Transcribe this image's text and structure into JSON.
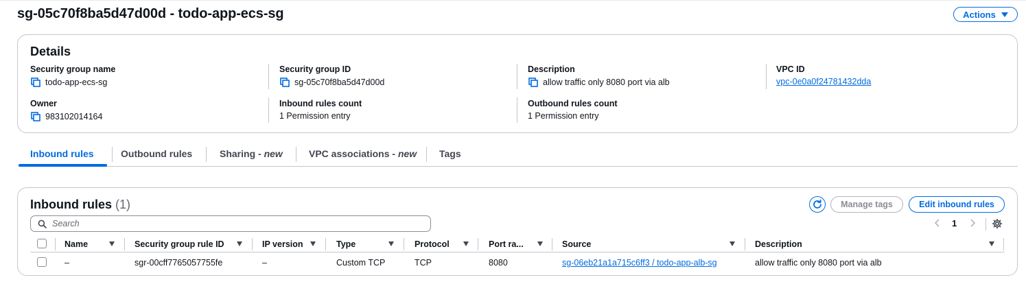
{
  "header": {
    "title": "sg-05c70f8ba5d47d00d - todo-app-ecs-sg",
    "actions_label": "Actions"
  },
  "details": {
    "title": "Details",
    "fields": {
      "sg_name": {
        "label": "Security group name",
        "value": "todo-app-ecs-sg"
      },
      "sg_id": {
        "label": "Security group ID",
        "value": "sg-05c70f8ba5d47d00d"
      },
      "description": {
        "label": "Description",
        "value": "allow traffic only 8080 port via alb"
      },
      "vpc_id": {
        "label": "VPC ID",
        "value": "vpc-0e0a0f24781432dda"
      },
      "owner": {
        "label": "Owner",
        "value": "983102014164"
      },
      "inbound_count": {
        "label": "Inbound rules count",
        "value": "1 Permission entry"
      },
      "outbound_count": {
        "label": "Outbound rules count",
        "value": "1 Permission entry"
      }
    }
  },
  "tabs": [
    {
      "label": "Inbound rules",
      "suffix": "",
      "active": true
    },
    {
      "label": "Outbound rules",
      "suffix": "",
      "active": false
    },
    {
      "label": "Sharing - ",
      "suffix": "new",
      "active": false
    },
    {
      "label": "VPC associations - ",
      "suffix": "new",
      "active": false
    },
    {
      "label": "Tags",
      "suffix": "",
      "active": false
    }
  ],
  "rules": {
    "title": "Inbound rules",
    "count": "(1)",
    "manage_tags_label": "Manage tags",
    "edit_label": "Edit inbound rules",
    "search_placeholder": "Search",
    "pagination": {
      "prev": "‹",
      "page": "1",
      "next": "›"
    },
    "columns": [
      "Name",
      "Security group rule ID",
      "IP version",
      "Type",
      "Protocol",
      "Port ra...",
      "Source",
      "Description"
    ],
    "rows": [
      {
        "name": "–",
        "rule_id": "sgr-00cff7765057755fe",
        "ip_version": "–",
        "type": "Custom TCP",
        "protocol": "TCP",
        "port_range": "8080",
        "source": "sg-06eb21a1a715c6ff3 / todo-app-alb-sg",
        "description": "allow traffic only 8080 port via alb"
      }
    ]
  },
  "colors": {
    "accent": "#006ce0",
    "border": "#c6c6cd",
    "text": "#0f141a",
    "muted": "#656871"
  }
}
